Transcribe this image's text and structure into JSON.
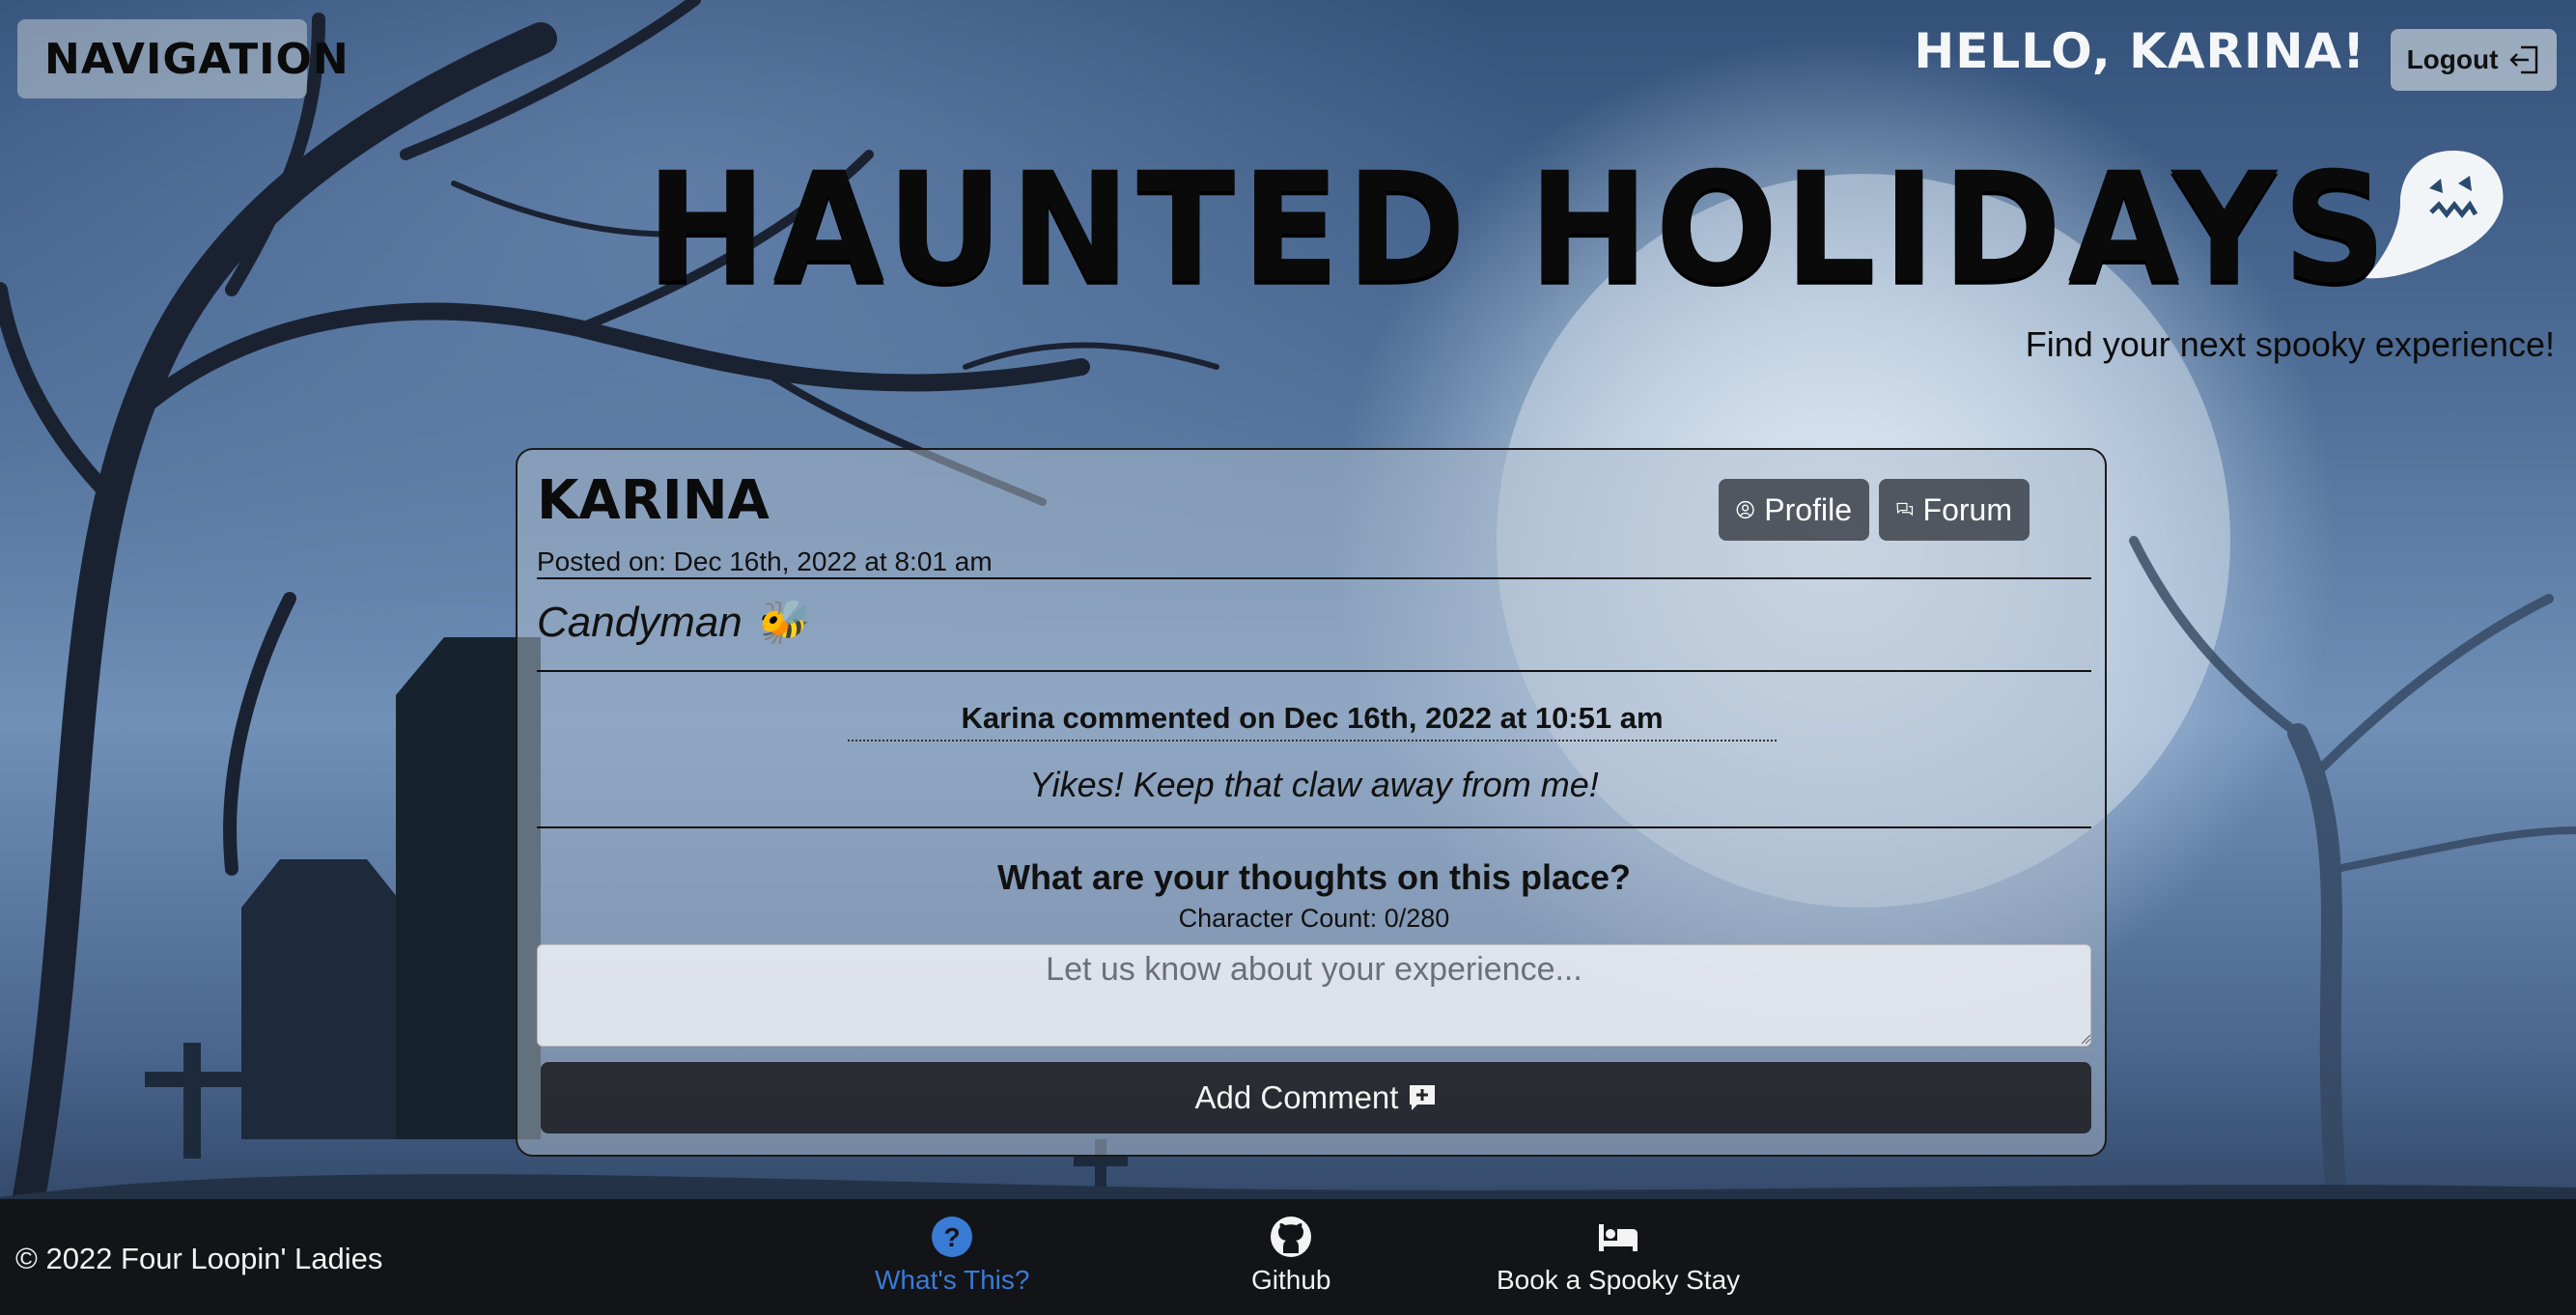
{
  "header": {
    "nav_label": "Navigation",
    "greeting": "Hello, Karina!",
    "logout_label": "Logout",
    "brand_title": "Haunted Holidays",
    "tagline": "Find your next spooky experience!"
  },
  "post": {
    "author": "Karina",
    "posted_on": "Posted on: Dec 16th, 2022 at 8:01 am",
    "title": "Candyman 🐝",
    "profile_label": "Profile",
    "forum_label": "Forum",
    "comment": {
      "heading": "Karina commented on Dec 16th, 2022 at 10:51 am",
      "body": "Yikes! Keep that claw away from me!"
    },
    "form": {
      "prompt": "What are your thoughts on this place?",
      "char_count": "Character Count: 0/280",
      "placeholder": "Let us know about your experience...",
      "submit_label": "Add Comment"
    }
  },
  "footer": {
    "copyright": "© 2022 Four Loopin' Ladies",
    "links": [
      "What's This?",
      "Github",
      "Book a Spooky Stay"
    ]
  },
  "colors": {
    "footer_bg": "#121418",
    "active_link": "#3a7bd5",
    "pill_bg": "#3c424a"
  }
}
